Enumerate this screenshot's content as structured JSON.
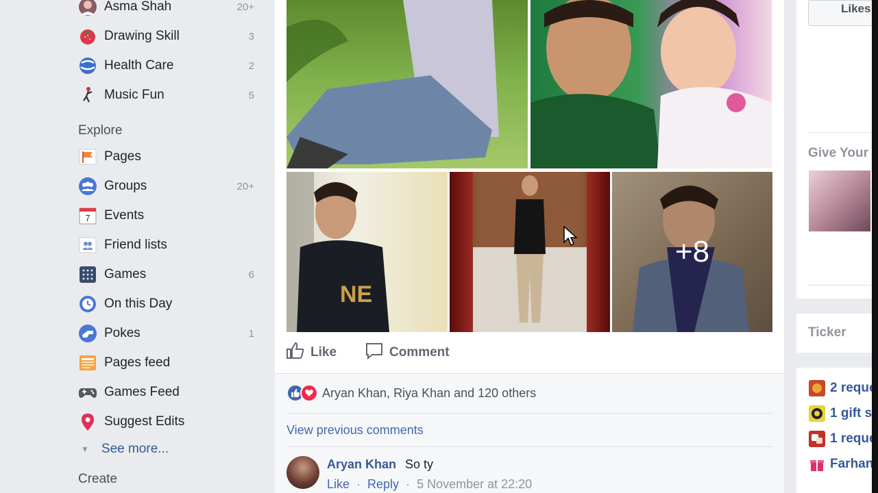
{
  "sidebar": {
    "shortcuts": [
      {
        "label": "Asma Shah",
        "count": "20+",
        "icon": "avatar-icon"
      },
      {
        "label": "Drawing Skill",
        "count": "3",
        "icon": "strawberry-icon"
      },
      {
        "label": "Health Care",
        "count": "2",
        "icon": "globe-icon"
      },
      {
        "label": "Music Fun",
        "count": "5",
        "icon": "dancer-icon"
      }
    ],
    "explore_heading": "Explore",
    "explore": [
      {
        "label": "Pages",
        "count": "",
        "icon": "flag-icon"
      },
      {
        "label": "Groups",
        "count": "20+",
        "icon": "groups-icon"
      },
      {
        "label": "Events",
        "count": "",
        "icon": "calendar-icon",
        "day": "7"
      },
      {
        "label": "Friend lists",
        "count": "",
        "icon": "friends-list-icon"
      },
      {
        "label": "Games",
        "count": "6",
        "icon": "games-icon"
      },
      {
        "label": "On this Day",
        "count": "",
        "icon": "clock-icon"
      },
      {
        "label": "Pokes",
        "count": "1",
        "icon": "poke-icon"
      },
      {
        "label": "Pages feed",
        "count": "",
        "icon": "pages-feed-icon"
      },
      {
        "label": "Games Feed",
        "count": "",
        "icon": "gamepad-icon"
      },
      {
        "label": "Suggest Edits",
        "count": "",
        "icon": "map-pin-icon"
      }
    ],
    "see_more": "See more...",
    "create_heading": "Create"
  },
  "post": {
    "more_photos_overlay": "+8",
    "actions": {
      "like": "Like",
      "comment": "Comment"
    },
    "reactions": {
      "text": "Aryan Khan, Riya Khan and 120 others",
      "icons": [
        "like-reaction-icon",
        "love-reaction-icon"
      ]
    },
    "view_previous": "View previous comments",
    "comment": {
      "author": "Aryan Khan",
      "text": "So ty",
      "like": "Like",
      "reply": "Reply",
      "time": "5 November at 22:20"
    }
  },
  "right": {
    "likes_button": "Likes",
    "give_your": "Give Your",
    "ticker": "Ticker",
    "notifications": [
      {
        "text": "2 reque",
        "icon": "game-request-icon"
      },
      {
        "text": "1 gift s",
        "icon": "gift-game-icon"
      },
      {
        "text": "1 reque",
        "icon": "dice-request-icon"
      },
      {
        "text": "Farhan",
        "icon": "present-icon"
      }
    ]
  },
  "colors": {
    "link": "#365899",
    "background": "#e9ebee",
    "like_blue": "#4267b2",
    "love_red": "#f0284a"
  }
}
